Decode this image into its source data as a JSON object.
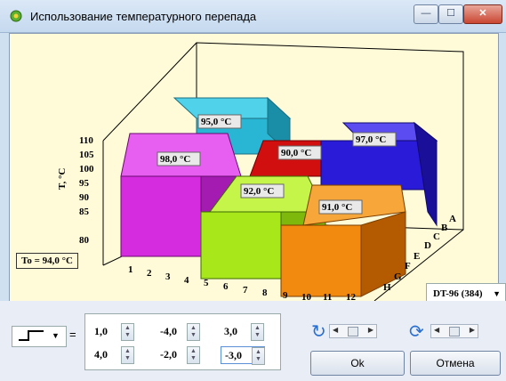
{
  "window": {
    "title": "Использование температурного перепада",
    "min_glyph": "—",
    "max_glyph": "☐",
    "close_glyph": "✕"
  },
  "colors": {
    "background": "#fffbd8",
    "blue_cyan": "#29b6d4",
    "red": "#d10f0f",
    "violet": "#2a1bd8",
    "magenta": "#d52ce0",
    "lime": "#a8e81b",
    "orange": "#f28a0f"
  },
  "chart_data": {
    "type": "bar",
    "subtype": "3d-block",
    "zlabel": "T, °C",
    "zticks": [
      "110",
      "105",
      "100",
      "95",
      "90",
      "85",
      "80"
    ],
    "x_ticks": [
      "1",
      "2",
      "3",
      "4",
      "5",
      "6",
      "7",
      "8",
      "9",
      "10",
      "11",
      "12"
    ],
    "y_ticks": [
      "A",
      "B",
      "C",
      "D",
      "E",
      "F",
      "G",
      "H"
    ],
    "blocks": [
      {
        "label": "95,0 °C",
        "value": 95.0,
        "color": "#29b6d4"
      },
      {
        "label": "90,0 °C",
        "value": 90.0,
        "color": "#d10f0f"
      },
      {
        "label": "97,0 °C",
        "value": 97.0,
        "color": "#2a1bd8"
      },
      {
        "label": "98,0 °C",
        "value": 98.0,
        "color": "#d52ce0"
      },
      {
        "label": "92,0 °C",
        "value": 92.0,
        "color": "#a8e81b"
      },
      {
        "label": "91,0 °C",
        "value": 91.0,
        "color": "#f28a0f"
      }
    ]
  },
  "to_label": "To = 94,0 °C",
  "device_select": "DT-96 (384)",
  "equals": "=",
  "coefficients": [
    [
      "1,0",
      "-4,0",
      "3,0"
    ],
    [
      "4,0",
      "-2,0",
      "-3,0"
    ]
  ],
  "buttons": {
    "ok": "Ok",
    "cancel": "Отмена"
  }
}
